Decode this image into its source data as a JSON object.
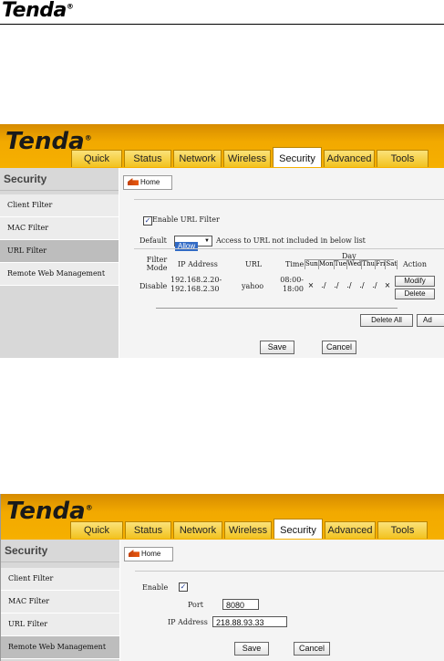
{
  "page": {
    "brand": "Tenda"
  },
  "tabs": [
    "Quick Setup",
    "Status",
    "Network",
    "Wireless",
    "Security",
    "Advanced",
    "Tools"
  ],
  "sidebar": {
    "title": "Security",
    "items": [
      "Client Filter",
      "MAC Filter",
      "URL Filter",
      "Remote Web Management"
    ]
  },
  "home_button": "Home",
  "url_filter": {
    "enable_label": "Enable URL Filter",
    "default_label": "Default",
    "default_value": "Allow",
    "access_text": "Access to URL not included in below list",
    "headers": {
      "filter_mode": "Filter Mode",
      "ip_address": "IP Address",
      "url": "URL",
      "time": "Time",
      "day": "Day",
      "action": "Action"
    },
    "days": [
      "Sun",
      "Mon",
      "Tue",
      "Wed",
      "Thu",
      "Fri",
      "Sat"
    ],
    "row": {
      "mode": "Disable",
      "ip": "192.168.2.20-192.168.2.30",
      "url": "yahoo",
      "time": "08:00-18:00",
      "day_marks": [
        "×",
        "./",
        "./",
        "./",
        "./",
        "./",
        "×"
      ]
    },
    "modify_label": "Modify",
    "delete_label": "Delete",
    "delete_all_label": "Delete All",
    "add_label": "Ad",
    "save_label": "Save",
    "cancel_label": "Cancel"
  },
  "remote": {
    "enable_label": "Enable",
    "port_label": "Port",
    "port_value": "8080",
    "ip_label": "IP Address",
    "ip_value": "218.88.93.33",
    "save_label": "Save",
    "cancel_label": "Cancel"
  },
  "colors": {
    "banner": "#f2a900",
    "sidebar": "#d8d8d8",
    "selection": "#316ac5"
  }
}
